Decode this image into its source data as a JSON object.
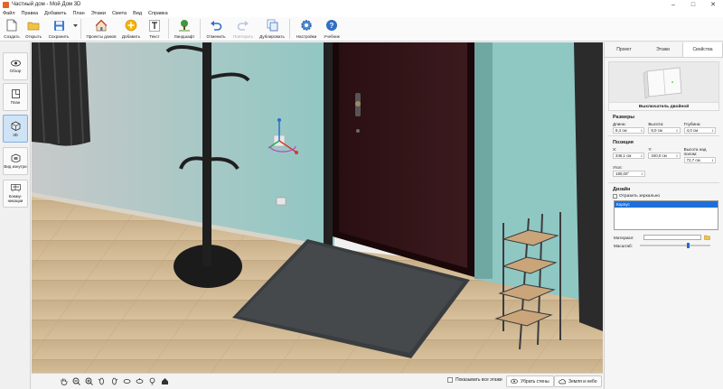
{
  "window": {
    "title": "Частный дом - Мой Дом 3D",
    "controls": [
      "–",
      "□",
      "✕"
    ]
  },
  "menu": [
    "Файл",
    "Правка",
    "Добавить",
    "План",
    "Этажи",
    "Смета",
    "Вид",
    "Справка"
  ],
  "toolbar": {
    "create": "Создать",
    "open": "Открыть",
    "save": "Сохранить",
    "presets": "Проекты домов",
    "add": "Добавить",
    "text": "Текст",
    "landscape": "Ландшафт",
    "undo": "Отменить",
    "redo": "Повторить",
    "duplicate": "Дублировать",
    "settings": "Настройки",
    "tutorial": "Учебник"
  },
  "leftbar": {
    "overview": "Обзор",
    "plan": "План",
    "view3d": "3D",
    "inside": "Вид изнутри",
    "communications": "Комму-никации"
  },
  "bottombar": {
    "show_all_floors": "Показывать все этажи",
    "hide_walls": "Убрать стены",
    "ground_sky": "Земля и небо"
  },
  "rightpanel": {
    "tabs": [
      "Проект",
      "Этажи",
      "Свойства"
    ],
    "active_tab": "Свойства",
    "object_name": "Выключатель двойной",
    "sizes_title": "Размеры",
    "length_label": "Длина:",
    "length_value": "8,4 см",
    "height_label": "Высота:",
    "height_value": "8,0 см",
    "depth_label": "Глубина:",
    "depth_value": "4,0 см",
    "position_title": "Позиция",
    "x_label": "X:",
    "x_value": "346,1 см",
    "y_label": "Y:",
    "y_value": "340,0 см",
    "elev_label": "Высота над полом:",
    "elev_value": "72,7 см",
    "angle_label": "Угол:",
    "angle_value": "180,00°",
    "design_title": "Дизайн",
    "mirror_label": "Отразить зеркально",
    "part_selected": "Корпус",
    "material_label": "Материал:",
    "scale_label": "Масштаб:",
    "scale_level": 0.7
  }
}
